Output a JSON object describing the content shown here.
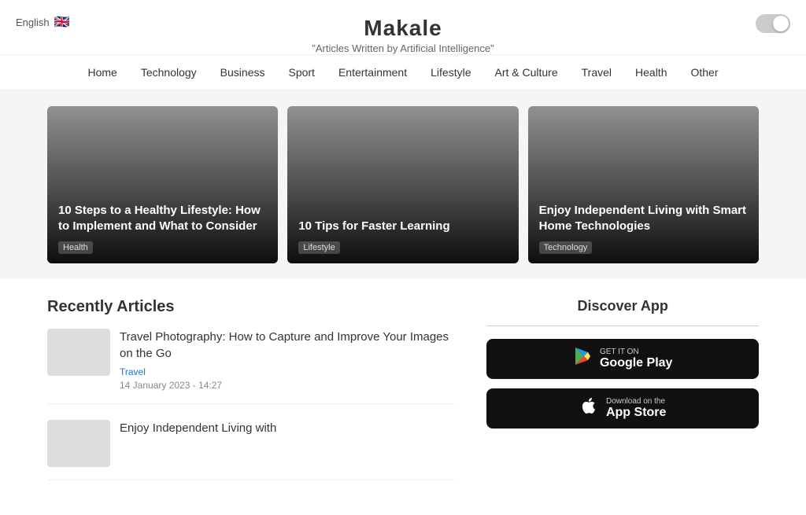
{
  "header": {
    "lang": "English",
    "flag": "🇬🇧",
    "title": "Makale",
    "subtitle": "\"Articles Written by Artificial Intelligence\""
  },
  "nav": {
    "items": [
      {
        "label": "Home",
        "href": "#"
      },
      {
        "label": "Technology",
        "href": "#"
      },
      {
        "label": "Business",
        "href": "#"
      },
      {
        "label": "Sport",
        "href": "#"
      },
      {
        "label": "Entertainment",
        "href": "#"
      },
      {
        "label": "Lifestyle",
        "href": "#"
      },
      {
        "label": "Art & Culture",
        "href": "#"
      },
      {
        "label": "Travel",
        "href": "#"
      },
      {
        "label": "Health",
        "href": "#"
      },
      {
        "label": "Other",
        "href": "#"
      }
    ]
  },
  "featured_cards": [
    {
      "title": "10 Steps to a Healthy Lifestyle: How to Implement and What to Consider",
      "tag": "Health"
    },
    {
      "title": "10 Tips for Faster Learning",
      "tag": "Lifestyle"
    },
    {
      "title": "Enjoy Independent Living with Smart Home Technologies",
      "tag": "Technology"
    }
  ],
  "recent_section": {
    "heading": "Recently Articles",
    "articles": [
      {
        "title": "Travel Photography: How to Capture and Improve Your Images on the Go",
        "tag": "Travel",
        "date": "14 January 2023 - 14:27"
      },
      {
        "title": "Enjoy Independent Living with",
        "tag": "",
        "date": ""
      }
    ]
  },
  "app_section": {
    "heading": "Discover App",
    "google_play": {
      "sub": "GET IT ON",
      "label": "Google Play"
    },
    "app_store": {
      "sub": "Download on the",
      "label": "App Store"
    }
  }
}
